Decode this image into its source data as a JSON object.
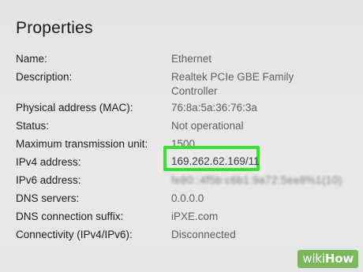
{
  "title": "Properties",
  "rows": [
    {
      "label": "Name:",
      "value": "Ethernet"
    },
    {
      "label": "Description:",
      "value": "Realtek PCIe GBE Family",
      "value_line2": "Controller"
    },
    {
      "label": "Physical address (MAC):",
      "value": "76:8a:5a:36:76:3a"
    },
    {
      "label": "Status:",
      "value": "Not operational"
    },
    {
      "label": "Maximum transmission unit:",
      "value": "1500"
    },
    {
      "label": "IPv4 address:",
      "value": "169.262.62.169/11"
    },
    {
      "label": "IPv6 address:",
      "value": "fe80::4f5b:c6b1:9a72:5ee8%1(10)"
    },
    {
      "label": "DNS servers:",
      "value": "0.0.0.0"
    },
    {
      "label": "DNS connection suffix:",
      "value": "iPXE.com"
    },
    {
      "label": "Connectivity (IPv4/IPv6):",
      "value": "Disconnected"
    }
  ],
  "watermark": {
    "part1": "wiki",
    "part2": "How"
  },
  "colors": {
    "highlight": "#35e22e",
    "watermark_bg": "#7bb85b"
  }
}
